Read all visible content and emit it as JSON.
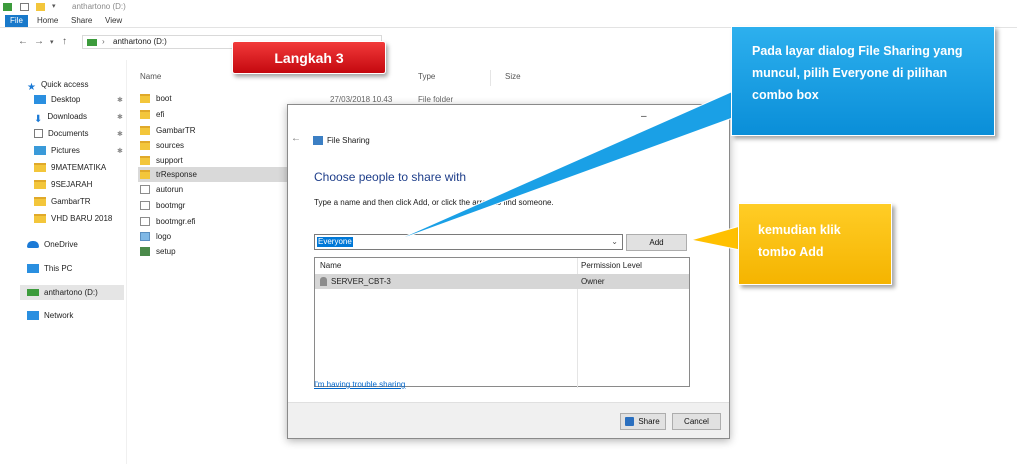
{
  "window": {
    "title": "anthartono (D:)"
  },
  "ribbon": {
    "tabs": [
      "File",
      "Home",
      "Share",
      "View"
    ]
  },
  "address": {
    "path": "anthartono (D:)"
  },
  "nav_pane": {
    "items": [
      {
        "label": "Quick access",
        "icon": "star-icon"
      },
      {
        "label": "Desktop",
        "icon": "desktop-icon",
        "pinned": true
      },
      {
        "label": "Downloads",
        "icon": "download-icon",
        "pinned": true
      },
      {
        "label": "Documents",
        "icon": "documents-icon",
        "pinned": true
      },
      {
        "label": "Pictures",
        "icon": "pictures-icon",
        "pinned": true
      },
      {
        "label": "9MATEMATIKA",
        "icon": "folder-icon"
      },
      {
        "label": "9SEJARAH",
        "icon": "folder-icon"
      },
      {
        "label": "GambarTR",
        "icon": "folder-icon"
      },
      {
        "label": "VHD BARU 2018",
        "icon": "folder-icon"
      },
      {
        "label": "OneDrive",
        "icon": "cloud-icon"
      },
      {
        "label": "This PC",
        "icon": "pc-icon"
      },
      {
        "label": "anthartono (D:)",
        "icon": "drive-icon"
      },
      {
        "label": "Network",
        "icon": "network-icon"
      }
    ]
  },
  "file_list": {
    "columns": [
      "Name",
      "Type",
      "Size"
    ],
    "first_date": "27/03/2018 10.43",
    "first_type": "File folder",
    "items": [
      {
        "name": "boot",
        "icon": "folder"
      },
      {
        "name": "efi",
        "icon": "folder"
      },
      {
        "name": "GambarTR",
        "icon": "folder"
      },
      {
        "name": "sources",
        "icon": "folder"
      },
      {
        "name": "support",
        "icon": "folder"
      },
      {
        "name": "trResponse",
        "icon": "folder"
      },
      {
        "name": "autorun",
        "icon": "settings-file"
      },
      {
        "name": "bootmgr",
        "icon": "file"
      },
      {
        "name": "bootmgr.efi",
        "icon": "file"
      },
      {
        "name": "logo",
        "icon": "image-file"
      },
      {
        "name": "setup",
        "icon": "setup-file"
      }
    ]
  },
  "dialog": {
    "title": "File Sharing",
    "heading": "Choose people to share with",
    "instruction": "Type a name and then click Add, or click the arrow to find someone.",
    "combo_value": "Everyone",
    "add_label": "Add",
    "col_name": "Name",
    "col_permission": "Permission Level",
    "row_name": "SERVER_CBT-3",
    "row_permission": "Owner",
    "trouble_link": "I'm having trouble sharing",
    "share_label": "Share",
    "cancel_label": "Cancel"
  },
  "callouts": {
    "step": "Langkah 3",
    "dialog_hint": "Pada layar dialog File Sharing yang muncul, pilih Everyone di pilihan combo box",
    "add_hint": "kemudian klik tombo Add"
  },
  "colors": {
    "accent_blue": "#0078d7",
    "callout_blue": "#1aa0e6",
    "callout_yellow": "#ffc000",
    "step_red": "#e0141b"
  }
}
